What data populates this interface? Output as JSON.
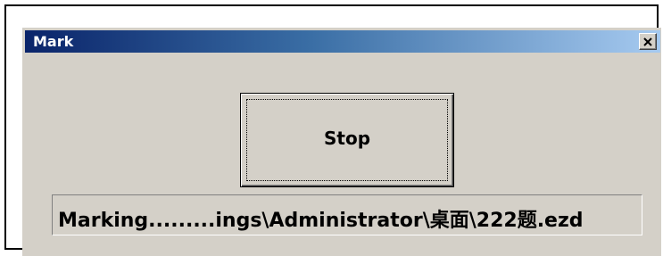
{
  "window": {
    "title": "Mark",
    "close_icon": "close-x-icon"
  },
  "main": {
    "stop_label": "Stop",
    "status_text": "Marking.........ings\\Administrator\\桌面\\222题.ezd"
  },
  "colors": {
    "titlebar_start": "#0a246a",
    "titlebar_end": "#a6caf0",
    "dialog_bg": "#d4d0c8"
  }
}
